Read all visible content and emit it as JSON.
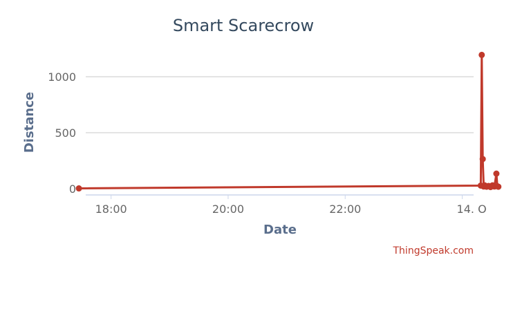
{
  "chart_data": {
    "type": "line",
    "title": "Smart Scarecrow",
    "xlabel": "Date",
    "ylabel": "Distance",
    "credit": "ThingSpeak.com",
    "x_tick_labels": [
      "18:00",
      "20:00",
      "22:00",
      "14. O"
    ],
    "y_tick_labels": [
      "0",
      "500",
      "1000"
    ],
    "ylim": [
      -40,
      1200
    ],
    "grid": true,
    "legend": "none",
    "colors": {
      "series": "#c0392b",
      "grid": "#c8c8c8",
      "axis": "#ccd6eb"
    },
    "series": [
      {
        "points": [
          {
            "x": "17:27",
            "y": 3
          },
          {
            "x": "00:19",
            "y": 28
          },
          {
            "x": "00:20",
            "y": 1195
          },
          {
            "x": "00:21",
            "y": 265
          },
          {
            "x": "00:22",
            "y": 20
          },
          {
            "x": "00:23",
            "y": 30
          },
          {
            "x": "00:25",
            "y": 18
          },
          {
            "x": "00:27",
            "y": 25
          },
          {
            "x": "00:29",
            "y": 15
          },
          {
            "x": "00:31",
            "y": 30
          },
          {
            "x": "00:33",
            "y": 20
          },
          {
            "x": "00:35",
            "y": 135
          },
          {
            "x": "00:36",
            "y": 22
          },
          {
            "x": "00:37",
            "y": 18
          }
        ]
      }
    ]
  }
}
